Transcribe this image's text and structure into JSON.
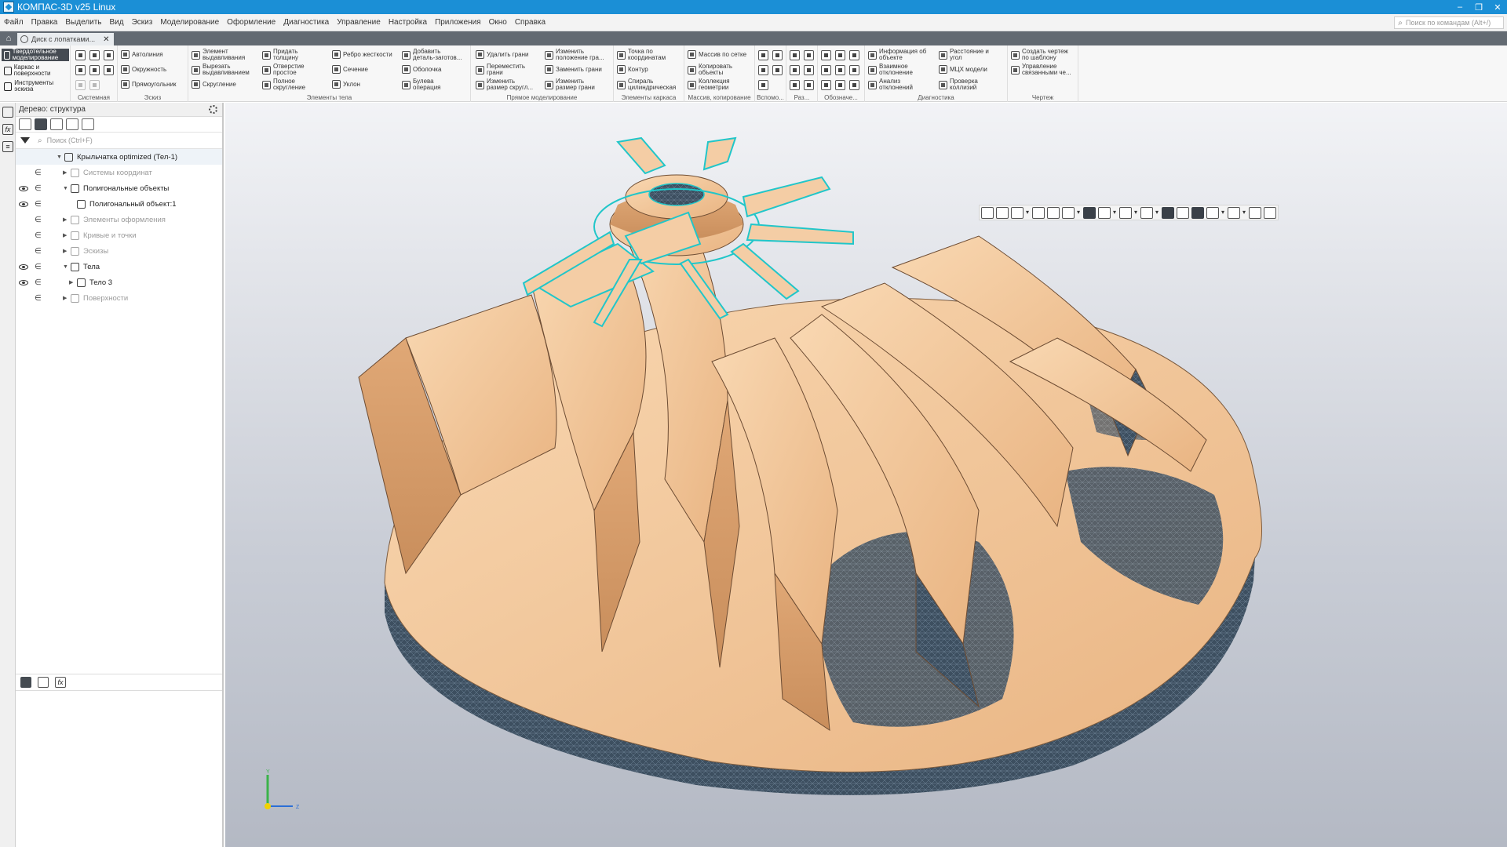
{
  "window": {
    "title": "КОМПАС-3D v25 Linux",
    "controls": [
      "–",
      "❐",
      "✕"
    ]
  },
  "menu": {
    "items": [
      "Файл",
      "Правка",
      "Выделить",
      "Вид",
      "Эскиз",
      "Моделирование",
      "Оформление",
      "Диагностика",
      "Управление",
      "Настройка",
      "Приложения",
      "Окно",
      "Справка"
    ],
    "command_search_placeholder": "Поиск по командам (Alt+/)"
  },
  "tabs": {
    "document_tab": "Диск с лопатками...",
    "close": "✕"
  },
  "ribbon": {
    "modes": [
      "Твердотельное моделирование",
      "Каркас и поверхности",
      "Инструменты эскиза"
    ],
    "groups": [
      "Системная",
      "Эскиз",
      "Элементы тела",
      "Прямое моделирование",
      "Элементы каркаса",
      "Массив, копирование",
      "Вспомо...",
      "Раз...",
      "Обозначе...",
      "Диагностика",
      "Чертеж"
    ],
    "sketch": [
      "Автолиния",
      "Окружность",
      "Прямоугольник"
    ],
    "body_col1": [
      "Элемент\nвыдавливания",
      "Вырезать\nвыдавливанием",
      "Скругление"
    ],
    "body_col2": [
      "Придать\nтолщину",
      "Отверстие\nпростое",
      "Полное\nскругление"
    ],
    "body_col3": [
      "Ребро жесткости",
      "Сечение",
      "Уклон"
    ],
    "body_col4": [
      "Добавить\nдеталь-заготов...",
      "Оболочка",
      "Булева\nоперация"
    ],
    "direct_col1": [
      "Удалить грани",
      "Переместить\nграни",
      "Изменить\nразмер скругл..."
    ],
    "direct_col2": [
      "Изменить\nположение гра...",
      "Заменить грани",
      "Изменить\nразмер грани"
    ],
    "frame": [
      "Точка по\nкоординатам",
      "Контур",
      "Спираль\nцилиндрическая"
    ],
    "array": [
      "Массив по сетке",
      "Копировать\nобъекты",
      "Коллекция\nгеометрии"
    ],
    "diag_col1": [
      "Информация об\nобъекте",
      "Взаимное\nотклонение",
      "Анализ\nотклонений"
    ],
    "diag_col2": [
      "Расстояние и\nугол",
      "МЦХ модели",
      "Проверка\nколлизий"
    ],
    "drawing": [
      "Создать чертеж\nпо шаблону",
      "Управление\nсвязанными че..."
    ]
  },
  "tree": {
    "panel_title": "Дерево: структура",
    "search_placeholder": "Поиск (Ctrl+F)",
    "items": [
      {
        "label": "Крыльчатка optimized (Тел-1)"
      },
      {
        "label": "Системы координат"
      },
      {
        "label": "Полигональные объекты"
      },
      {
        "label": "Полигональный объект:1"
      },
      {
        "label": "Элементы оформления"
      },
      {
        "label": "Кривые и точки"
      },
      {
        "label": "Эскизы"
      },
      {
        "label": "Тела"
      },
      {
        "label": "Тело 3"
      },
      {
        "label": "Поверхности"
      }
    ]
  },
  "viewport": {
    "triad_labels": [
      "Y",
      "Z"
    ]
  },
  "colors": {
    "titlebar": "#1b8fd6",
    "model_surface": "#f2c598",
    "mesh_dark": "#35495c",
    "selection_edges": "#21c6c9"
  }
}
